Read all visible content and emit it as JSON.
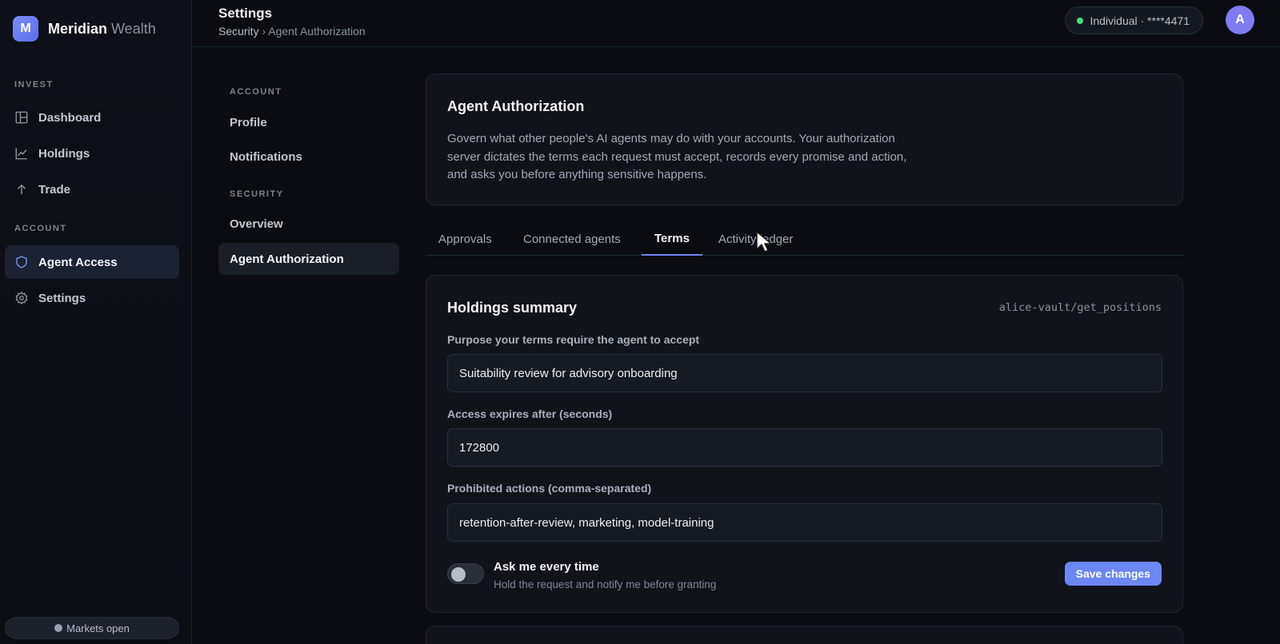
{
  "brand": {
    "logo_letter": "M",
    "name": "Meridian",
    "suffix": "Wealth"
  },
  "sidebar": {
    "sections": [
      "INVEST",
      "ACCOUNT"
    ],
    "items": [
      {
        "label": "Dashboard",
        "icon": "dashboard-icon"
      },
      {
        "label": "Holdings",
        "icon": "chart-line-icon"
      },
      {
        "label": "Trade",
        "icon": "arrow-up-icon"
      },
      {
        "label": "Agent Access",
        "icon": "shield-icon",
        "active": true
      },
      {
        "label": "Settings",
        "icon": "gear-icon"
      }
    ],
    "status": "Markets open"
  },
  "header": {
    "title": "Settings",
    "breadcrumb": [
      "Security",
      "Agent Authorization"
    ],
    "breadcrumb_sep": "›",
    "account": "Individual · ****4471",
    "avatar": "A"
  },
  "settings_nav": {
    "sections": [
      "ACCOUNT",
      "SECURITY"
    ],
    "items": [
      {
        "label": "Profile"
      },
      {
        "label": "Notifications"
      },
      {
        "label": "Overview"
      },
      {
        "label": "Agent Authorization",
        "active": true
      }
    ]
  },
  "intro": {
    "title": "Agent Authorization",
    "description": "Govern what other people's AI agents may do with your accounts. Your authorization server dictates the terms each request must accept, records every promise and action, and asks you before anything sensitive happens."
  },
  "tabs": [
    {
      "label": "Approvals"
    },
    {
      "label": "Connected agents"
    },
    {
      "label": "Terms",
      "active": true
    },
    {
      "label": "Activity ledger"
    }
  ],
  "terms": {
    "title": "Holdings summary",
    "tool": "alice-vault/get_positions",
    "purpose_label": "Purpose your terms require the agent to accept",
    "purpose_value": "Suitability review for advisory onboarding",
    "expiry_label": "Access expires after (seconds)",
    "expiry_value": "172800",
    "prohibited_label": "Prohibited actions (comma-separated)",
    "prohibited_value": "retention-after-review, marketing, model-training",
    "ask_label": "Ask me every time",
    "ask_hint": "Hold the request and notify me before granting",
    "ask_enabled": false,
    "save_label": "Save changes"
  },
  "colors": {
    "accent": "#6c86f2",
    "status_ok": "#4ade80",
    "avatar": "#7f7cf3"
  }
}
